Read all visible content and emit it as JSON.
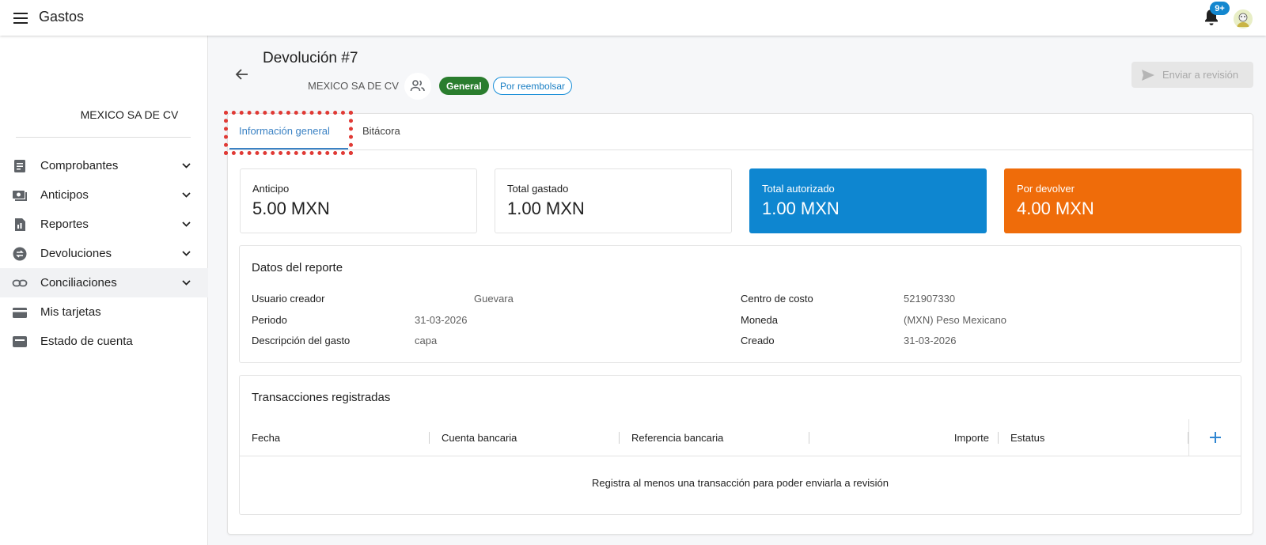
{
  "app": {
    "title": "Gastos",
    "notification_badge": "9+"
  },
  "sidebar": {
    "company": "MEXICO SA DE CV",
    "items": [
      {
        "label": "Comprobantes",
        "icon": "receipt-icon",
        "expandable": true
      },
      {
        "label": "Anticipos",
        "icon": "cash-icon",
        "expandable": true
      },
      {
        "label": "Reportes",
        "icon": "report-icon",
        "expandable": true
      },
      {
        "label": "Devoluciones",
        "icon": "exchange-icon",
        "expandable": true
      },
      {
        "label": "Conciliaciones",
        "icon": "link-icon",
        "expandable": true,
        "active": true
      },
      {
        "label": "Mis tarjetas",
        "icon": "credit-card-icon",
        "expandable": false
      },
      {
        "label": "Estado de cuenta",
        "icon": "wallet-icon",
        "expandable": false
      }
    ]
  },
  "header": {
    "title": "Devolución #7",
    "org": "MEXICO SA DE CV",
    "chip_general": "General",
    "chip_status": "Por reembolsar",
    "send_button": "Enviar a revisión"
  },
  "tabs": {
    "info": "Información general",
    "log": "Bitácora"
  },
  "stats": [
    {
      "label": "Anticipo",
      "value": "5.00 MXN",
      "color": "#ffffff"
    },
    {
      "label": "Total gastado",
      "value": "1.00 MXN",
      "color": "#ffffff"
    },
    {
      "label": "Total autorizado",
      "value": "1.00 MXN",
      "color": "#0e86d0"
    },
    {
      "label": "Por devolver",
      "value": "4.00 MXN",
      "color": "#ef6c0a"
    }
  ],
  "report": {
    "title": "Datos del reporte",
    "left": [
      {
        "key": "Usuario creador",
        "value": "Guevara"
      },
      {
        "key": "Periodo",
        "value": "31-03-2026"
      },
      {
        "key": "Descripción del gasto",
        "value": "capa"
      }
    ],
    "right": [
      {
        "key": "Centro de costo",
        "value": "521907330"
      },
      {
        "key": "Moneda",
        "value": "(MXN) Peso Mexicano"
      },
      {
        "key": "Creado",
        "value": "31-03-2026"
      }
    ]
  },
  "transactions": {
    "title": "Transacciones registradas",
    "columns": [
      "Fecha",
      "Cuenta bancaria",
      "Referencia bancaria",
      "Importe",
      "Estatus"
    ],
    "empty_message": "Registra al menos una transacción para poder enviarla a revisión"
  },
  "colors": {
    "accent": "#3b82c4",
    "general_chip": "#2a7d2e",
    "highlight": "#e03a35"
  }
}
